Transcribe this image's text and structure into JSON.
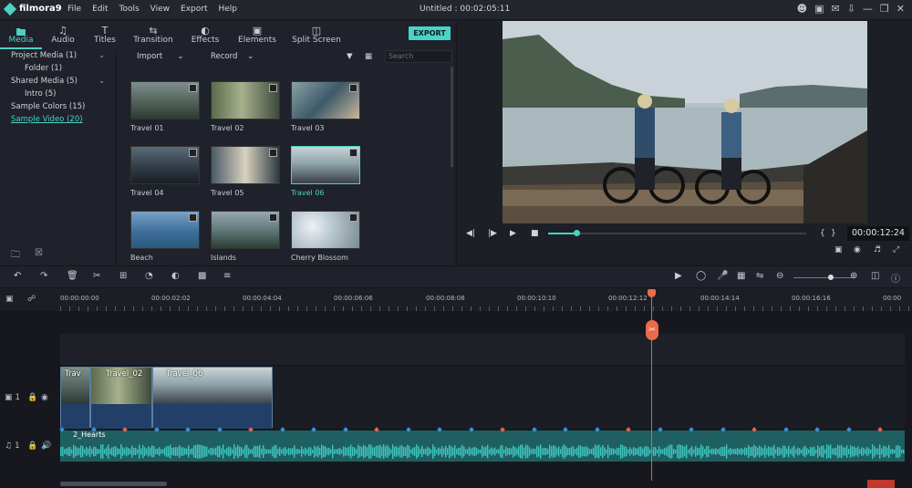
{
  "app": {
    "name": "filmora9",
    "window_title": "Untitled : 00:02:05:11"
  },
  "menu": [
    "File",
    "Edit",
    "Tools",
    "View",
    "Export",
    "Help"
  ],
  "tabs": [
    {
      "label": "Media",
      "icon": "folder-icon"
    },
    {
      "label": "Audio",
      "icon": "music-note-icon"
    },
    {
      "label": "Titles",
      "icon": "text-icon"
    },
    {
      "label": "Transition",
      "icon": "transition-icon"
    },
    {
      "label": "Effects",
      "icon": "effects-icon"
    },
    {
      "label": "Elements",
      "icon": "elements-icon"
    },
    {
      "label": "Split Screen",
      "icon": "split-screen-icon"
    }
  ],
  "export_label": "EXPORT",
  "library": [
    {
      "label": "Project Media (1)",
      "sub": false,
      "chevron": true
    },
    {
      "label": "Folder (1)",
      "sub": true
    },
    {
      "label": "Shared Media (5)",
      "sub": false,
      "chevron": true
    },
    {
      "label": "Intro (5)",
      "sub": true
    },
    {
      "label": "Sample Colors (15)",
      "sub": false
    },
    {
      "label": "Sample Video (20)",
      "sub": false,
      "active": true
    }
  ],
  "media_toolbar": {
    "import": "Import",
    "record": "Record",
    "search_placeholder": "Search"
  },
  "media_items": [
    {
      "label": "Travel 01"
    },
    {
      "label": "Travel 02"
    },
    {
      "label": "Travel 03"
    },
    {
      "label": "Travel 04"
    },
    {
      "label": "Travel 05"
    },
    {
      "label": "Travel 06",
      "selected": true
    },
    {
      "label": "Beach"
    },
    {
      "label": "Islands"
    },
    {
      "label": "Cherry Blossom"
    }
  ],
  "preview": {
    "timecode": "00:00:12:24",
    "progress": 0.11
  },
  "ruler": [
    "00:00:00:00",
    "00:00:02:02",
    "00:00:04:04",
    "00:00:06:06",
    "00:00:08:08",
    "00:00:10:10",
    "00:00:12:12",
    "00:00:14:14",
    "00:00:16:16",
    "00:00"
  ],
  "tracks": {
    "video_label": "1",
    "audio_label": "1",
    "clips": [
      {
        "name": "Trav"
      },
      {
        "name": "Travel_02"
      },
      {
        "name": "Travel_06"
      }
    ],
    "audio_clip": "2_Hearts"
  },
  "colors": {
    "accent": "#4ad3c5",
    "playhead": "#ec6a4c",
    "audio": "#1f5f62",
    "clip": "#2a4a70"
  }
}
